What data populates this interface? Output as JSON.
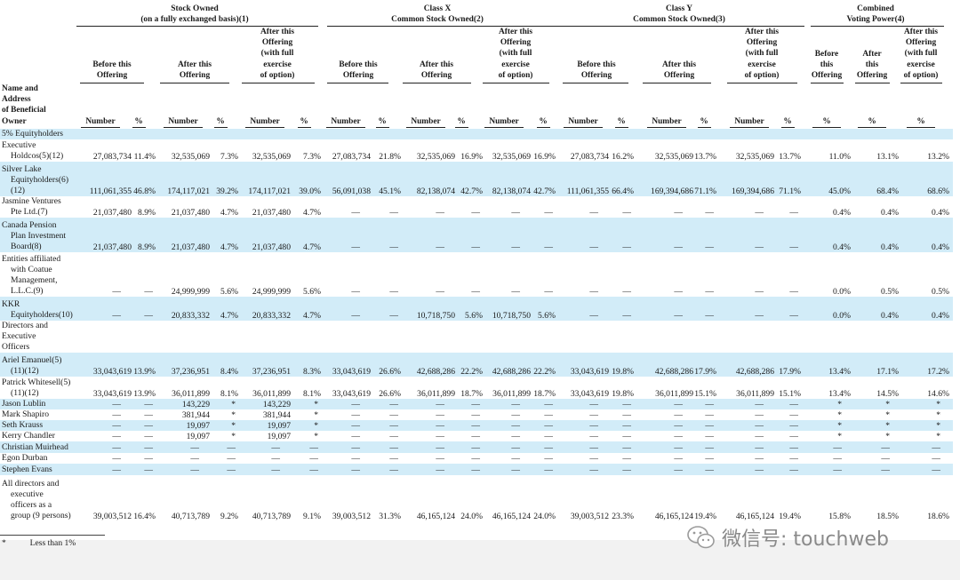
{
  "header": {
    "groups": [
      {
        "line1": "Stock Owned",
        "line2": "(on a fully exchanged basis)(1)"
      },
      {
        "line1": "Class X",
        "line2": "Common Stock Owned(2)"
      },
      {
        "line1": "Class Y",
        "line2": "Common Stock Owned(3)"
      },
      {
        "line1": "Combined",
        "line2": "Voting Power(4)"
      }
    ],
    "sub_before": [
      "Before this",
      "Offering"
    ],
    "sub_after": [
      "After this",
      "Offering"
    ],
    "sub_full": [
      "After this",
      "Offering",
      "(with full",
      "exercise",
      "of option)"
    ],
    "combined_before": [
      "Before",
      "this",
      "Offering"
    ],
    "combined_after": [
      "After",
      "this",
      "Offering"
    ],
    "name_col": [
      "Name and",
      "Address",
      "of Beneficial",
      "Owner"
    ],
    "number_label": "Number",
    "pct_label": "%"
  },
  "rows": [
    {
      "name": [
        "5% Equityholders"
      ],
      "section": true,
      "shade": true
    },
    {
      "name": [
        "Executive",
        "Holdcos(5)(12)"
      ],
      "shade": false,
      "values": [
        "27,083,734",
        "11.4%",
        "32,535,069",
        "7.3%",
        "32,535,069",
        "7.3%",
        "27,083,734",
        "21.8%",
        "32,535,069",
        "16.9%",
        "32,535,069",
        "16.9%",
        "27,083,734",
        "16.2%",
        "32,535,069",
        "13.7%",
        "32,535,069",
        "13.7%",
        "11.0%",
        "13.1%",
        "13.2%"
      ]
    },
    {
      "name": [
        "Silver Lake",
        "Equityholders(6)",
        "(12)"
      ],
      "shade": true,
      "values": [
        "111,061,355",
        "46.8%",
        "174,117,021",
        "39.2%",
        "174,117,021",
        "39.0%",
        "56,091,038",
        "45.1%",
        "82,138,074",
        "42.7%",
        "82,138,074",
        "42.7%",
        "111,061,355",
        "66.4%",
        "169,394,686",
        "71.1%",
        "169,394,686",
        "71.1%",
        "45.0%",
        "68.4%",
        "68.6%"
      ]
    },
    {
      "name": [
        "Jasmine Ventures",
        "Pte Ltd.(7)"
      ],
      "shade": false,
      "values": [
        "21,037,480",
        "8.9%",
        "21,037,480",
        "4.7%",
        "21,037,480",
        "4.7%",
        "—",
        "—",
        "—",
        "—",
        "—",
        "—",
        "—",
        "—",
        "—",
        "—",
        "—",
        "—",
        "0.4%",
        "0.4%",
        "0.4%"
      ]
    },
    {
      "name": [
        "Canada Pension",
        "Plan Investment",
        "Board(8)"
      ],
      "shade": true,
      "values": [
        "21,037,480",
        "8.9%",
        "21,037,480",
        "4.7%",
        "21,037,480",
        "4.7%",
        "—",
        "—",
        "—",
        "—",
        "—",
        "—",
        "—",
        "—",
        "—",
        "—",
        "—",
        "—",
        "0.4%",
        "0.4%",
        "0.4%"
      ]
    },
    {
      "name": [
        "Entities affiliated",
        "with Coatue",
        "Management,",
        "L.L.C.(9)"
      ],
      "shade": false,
      "values": [
        "—",
        "—",
        "24,999,999",
        "5.6%",
        "24,999,999",
        "5.6%",
        "—",
        "—",
        "—",
        "—",
        "—",
        "—",
        "—",
        "—",
        "—",
        "—",
        "—",
        "—",
        "0.0%",
        "0.5%",
        "0.5%"
      ]
    },
    {
      "name": [
        "KKR",
        "Equityholders(10)"
      ],
      "shade": true,
      "values": [
        "—",
        "—",
        "20,833,332",
        "4.7%",
        "20,833,332",
        "4.7%",
        "—",
        "—",
        "10,718,750",
        "5.6%",
        "10,718,750",
        "5.6%",
        "—",
        "—",
        "—",
        "—",
        "—",
        "—",
        "0.0%",
        "0.4%",
        "0.4%"
      ]
    },
    {
      "name": [
        "Directors and",
        "Executive",
        "Officers"
      ],
      "section": true,
      "shade": false
    },
    {
      "name": [
        "Ariel Emanuel(5)",
        "(11)(12)"
      ],
      "shade": true,
      "values": [
        "33,043,619",
        "13.9%",
        "37,236,951",
        "8.4%",
        "37,236,951",
        "8.3%",
        "33,043,619",
        "26.6%",
        "42,688,286",
        "22.2%",
        "42,688,286",
        "22.2%",
        "33,043,619",
        "19.8%",
        "42,688,286",
        "17.9%",
        "42,688,286",
        "17.9%",
        "13.4%",
        "17.1%",
        "17.2%"
      ]
    },
    {
      "name": [
        "Patrick Whitesell(5)",
        "(11)(12)"
      ],
      "shade": false,
      "values": [
        "33,043,619",
        "13.9%",
        "36,011,899",
        "8.1%",
        "36,011,899",
        "8.1%",
        "33,043,619",
        "26.6%",
        "36,011,899",
        "18.7%",
        "36,011,899",
        "18.7%",
        "33,043,619",
        "19.8%",
        "36,011,899",
        "15.1%",
        "36,011,899",
        "15.1%",
        "13.4%",
        "14.5%",
        "14.6%"
      ]
    },
    {
      "name": [
        "Jason Lublin"
      ],
      "shade": true,
      "values": [
        "—",
        "—",
        "143,229",
        "*",
        "143,229",
        "*",
        "—",
        "—",
        "—",
        "—",
        "—",
        "—",
        "—",
        "—",
        "—",
        "—",
        "—",
        "—",
        "*",
        "*",
        "*"
      ]
    },
    {
      "name": [
        "Mark Shapiro"
      ],
      "shade": false,
      "values": [
        "—",
        "—",
        "381,944",
        "*",
        "381,944",
        "*",
        "—",
        "—",
        "—",
        "—",
        "—",
        "—",
        "—",
        "—",
        "—",
        "—",
        "—",
        "—",
        "*",
        "*",
        "*"
      ]
    },
    {
      "name": [
        "Seth Krauss"
      ],
      "shade": true,
      "values": [
        "—",
        "—",
        "19,097",
        "*",
        "19,097",
        "*",
        "—",
        "—",
        "—",
        "—",
        "—",
        "—",
        "—",
        "—",
        "—",
        "—",
        "—",
        "—",
        "*",
        "*",
        "*"
      ]
    },
    {
      "name": [
        "Kerry Chandler"
      ],
      "shade": false,
      "values": [
        "—",
        "—",
        "19,097",
        "*",
        "19,097",
        "*",
        "—",
        "—",
        "—",
        "—",
        "—",
        "—",
        "—",
        "—",
        "—",
        "—",
        "—",
        "—",
        "*",
        "*",
        "*"
      ]
    },
    {
      "name": [
        "Christian Muirhead"
      ],
      "shade": true,
      "values": [
        "—",
        "—",
        "—",
        "—",
        "—",
        "—",
        "—",
        "—",
        "—",
        "—",
        "—",
        "—",
        "—",
        "—",
        "—",
        "—",
        "—",
        "—",
        "—",
        "—",
        "—"
      ]
    },
    {
      "name": [
        "Egon Durban"
      ],
      "shade": false,
      "values": [
        "—",
        "—",
        "—",
        "—",
        "—",
        "—",
        "—",
        "—",
        "—",
        "—",
        "—",
        "—",
        "—",
        "—",
        "—",
        "—",
        "—",
        "—",
        "—",
        "—",
        "—"
      ]
    },
    {
      "name": [
        "Stephen Evans"
      ],
      "shade": true,
      "values": [
        "—",
        "—",
        "—",
        "—",
        "—",
        "—",
        "—",
        "—",
        "—",
        "—",
        "—",
        "—",
        "—",
        "—",
        "—",
        "—",
        "—",
        "—",
        "—",
        "—",
        "—"
      ]
    },
    {
      "name": [
        "All directors and",
        "executive",
        "officers as a",
        "group (9 persons)"
      ],
      "shade": false,
      "values": [
        "39,003,512",
        "16.4%",
        "40,713,789",
        "9.2%",
        "40,713,789",
        "9.1%",
        "39,003,512",
        "31.3%",
        "46,165,124",
        "24.0%",
        "46,165,124",
        "24.0%",
        "39,003,512",
        "23.3%",
        "46,165,124",
        "19.4%",
        "46,165,124",
        "19.4%",
        "15.8%",
        "18.5%",
        "18.6%"
      ]
    }
  ],
  "footnote": {
    "marker": "*",
    "text": "Less than 1%"
  },
  "watermark": {
    "text": "微信号: touchweb",
    "icon": "wechat-icon"
  },
  "colors": {
    "band": "#d2ecf8",
    "watermark": "#8a8a8a"
  }
}
